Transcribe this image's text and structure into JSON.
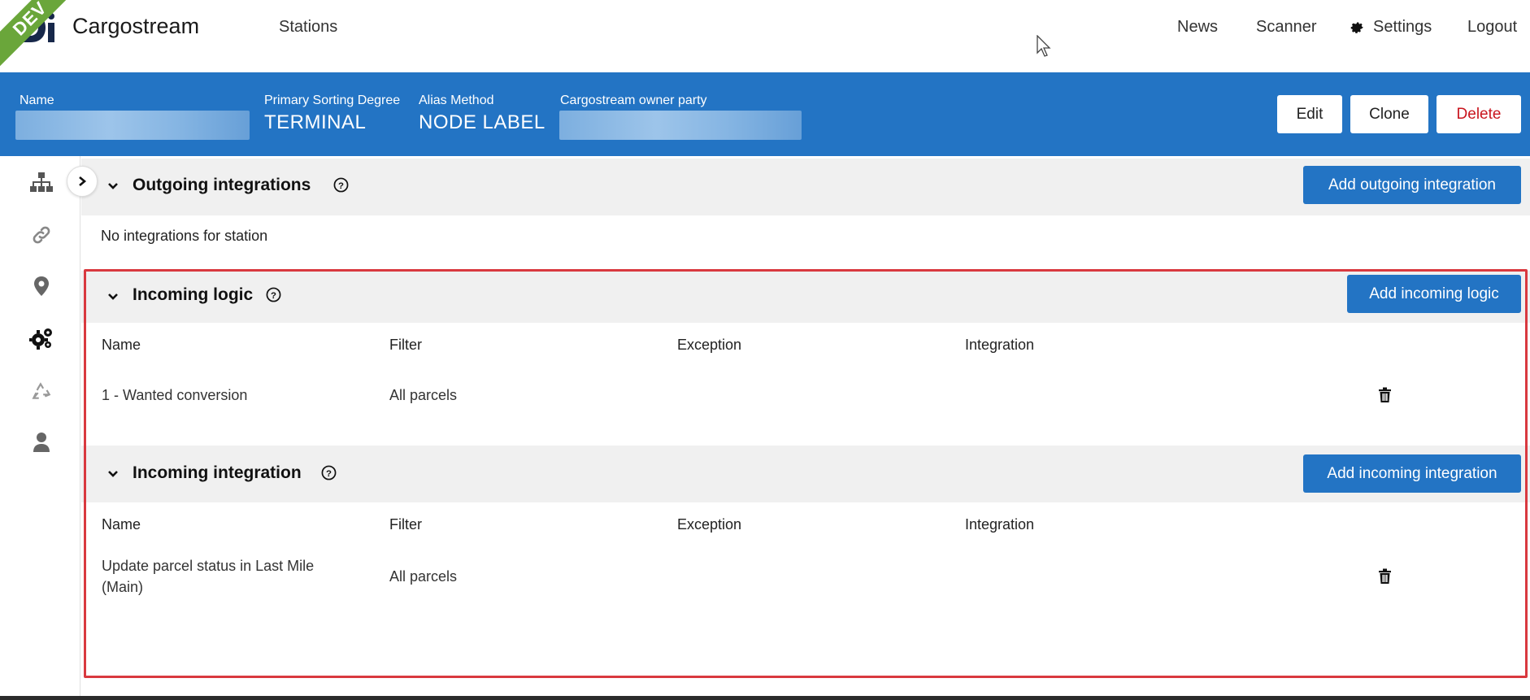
{
  "env_badge": "DEV",
  "brand": {
    "logo_text": "Di",
    "name": "Cargostream"
  },
  "nav": {
    "left": [
      {
        "label": "Stations"
      }
    ],
    "right": [
      {
        "label": "News"
      },
      {
        "label": "Scanner"
      },
      {
        "label": "Settings",
        "icon": "gear-icon"
      },
      {
        "label": "Logout"
      }
    ]
  },
  "station_header": {
    "fields": [
      {
        "label": "Name",
        "value": ""
      },
      {
        "label": "Primary Sorting Degree",
        "value": "TERMINAL"
      },
      {
        "label": "Alias Method",
        "value": "NODE LABEL"
      },
      {
        "label": "Cargostream owner party",
        "value": ""
      }
    ],
    "buttons": {
      "edit": "Edit",
      "clone": "Clone",
      "delete": "Delete"
    },
    "delete_color": "#c9151e"
  },
  "sidebar_icons": [
    "hierarchy-icon",
    "link-icon",
    "map-pin-icon",
    "cogs-icon",
    "recycle-icon",
    "user-icon"
  ],
  "sections": {
    "outgoing": {
      "title": "Outgoing integrations",
      "button": "Add outgoing integration",
      "empty_text": "No integrations for station"
    },
    "incoming_logic": {
      "title": "Incoming logic",
      "button": "Add incoming logic",
      "columns": [
        "Name",
        "Filter",
        "Exception",
        "Integration"
      ],
      "rows": [
        {
          "name": "1 - Wanted conversion",
          "filter": "All parcels",
          "exception": "",
          "integration": ""
        }
      ]
    },
    "incoming_integration": {
      "title": "Incoming integration",
      "button": "Add incoming integration",
      "columns": [
        "Name",
        "Filter",
        "Exception",
        "Integration"
      ],
      "rows": [
        {
          "name_line1": "Update parcel status in Last Mile",
          "name_line2": "(Main)",
          "filter": "All parcels",
          "exception": "",
          "integration": ""
        }
      ]
    }
  },
  "colors": {
    "primary_blue": "#2374c4",
    "highlight_red": "#d9393f",
    "dev_green": "#6aa63a"
  }
}
